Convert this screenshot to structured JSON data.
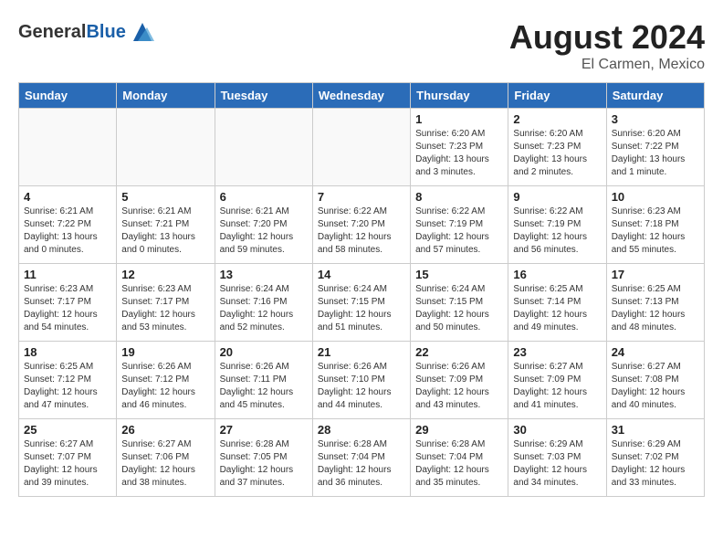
{
  "header": {
    "logo_general": "General",
    "logo_blue": "Blue",
    "month_year": "August 2024",
    "location": "El Carmen, Mexico"
  },
  "days_of_week": [
    "Sunday",
    "Monday",
    "Tuesday",
    "Wednesday",
    "Thursday",
    "Friday",
    "Saturday"
  ],
  "weeks": [
    [
      {
        "day": "",
        "info": ""
      },
      {
        "day": "",
        "info": ""
      },
      {
        "day": "",
        "info": ""
      },
      {
        "day": "",
        "info": ""
      },
      {
        "day": "1",
        "info": "Sunrise: 6:20 AM\nSunset: 7:23 PM\nDaylight: 13 hours\nand 3 minutes."
      },
      {
        "day": "2",
        "info": "Sunrise: 6:20 AM\nSunset: 7:23 PM\nDaylight: 13 hours\nand 2 minutes."
      },
      {
        "day": "3",
        "info": "Sunrise: 6:20 AM\nSunset: 7:22 PM\nDaylight: 13 hours\nand 1 minute."
      }
    ],
    [
      {
        "day": "4",
        "info": "Sunrise: 6:21 AM\nSunset: 7:22 PM\nDaylight: 13 hours\nand 0 minutes."
      },
      {
        "day": "5",
        "info": "Sunrise: 6:21 AM\nSunset: 7:21 PM\nDaylight: 13 hours\nand 0 minutes."
      },
      {
        "day": "6",
        "info": "Sunrise: 6:21 AM\nSunset: 7:20 PM\nDaylight: 12 hours\nand 59 minutes."
      },
      {
        "day": "7",
        "info": "Sunrise: 6:22 AM\nSunset: 7:20 PM\nDaylight: 12 hours\nand 58 minutes."
      },
      {
        "day": "8",
        "info": "Sunrise: 6:22 AM\nSunset: 7:19 PM\nDaylight: 12 hours\nand 57 minutes."
      },
      {
        "day": "9",
        "info": "Sunrise: 6:22 AM\nSunset: 7:19 PM\nDaylight: 12 hours\nand 56 minutes."
      },
      {
        "day": "10",
        "info": "Sunrise: 6:23 AM\nSunset: 7:18 PM\nDaylight: 12 hours\nand 55 minutes."
      }
    ],
    [
      {
        "day": "11",
        "info": "Sunrise: 6:23 AM\nSunset: 7:17 PM\nDaylight: 12 hours\nand 54 minutes."
      },
      {
        "day": "12",
        "info": "Sunrise: 6:23 AM\nSunset: 7:17 PM\nDaylight: 12 hours\nand 53 minutes."
      },
      {
        "day": "13",
        "info": "Sunrise: 6:24 AM\nSunset: 7:16 PM\nDaylight: 12 hours\nand 52 minutes."
      },
      {
        "day": "14",
        "info": "Sunrise: 6:24 AM\nSunset: 7:15 PM\nDaylight: 12 hours\nand 51 minutes."
      },
      {
        "day": "15",
        "info": "Sunrise: 6:24 AM\nSunset: 7:15 PM\nDaylight: 12 hours\nand 50 minutes."
      },
      {
        "day": "16",
        "info": "Sunrise: 6:25 AM\nSunset: 7:14 PM\nDaylight: 12 hours\nand 49 minutes."
      },
      {
        "day": "17",
        "info": "Sunrise: 6:25 AM\nSunset: 7:13 PM\nDaylight: 12 hours\nand 48 minutes."
      }
    ],
    [
      {
        "day": "18",
        "info": "Sunrise: 6:25 AM\nSunset: 7:12 PM\nDaylight: 12 hours\nand 47 minutes."
      },
      {
        "day": "19",
        "info": "Sunrise: 6:26 AM\nSunset: 7:12 PM\nDaylight: 12 hours\nand 46 minutes."
      },
      {
        "day": "20",
        "info": "Sunrise: 6:26 AM\nSunset: 7:11 PM\nDaylight: 12 hours\nand 45 minutes."
      },
      {
        "day": "21",
        "info": "Sunrise: 6:26 AM\nSunset: 7:10 PM\nDaylight: 12 hours\nand 44 minutes."
      },
      {
        "day": "22",
        "info": "Sunrise: 6:26 AM\nSunset: 7:09 PM\nDaylight: 12 hours\nand 43 minutes."
      },
      {
        "day": "23",
        "info": "Sunrise: 6:27 AM\nSunset: 7:09 PM\nDaylight: 12 hours\nand 41 minutes."
      },
      {
        "day": "24",
        "info": "Sunrise: 6:27 AM\nSunset: 7:08 PM\nDaylight: 12 hours\nand 40 minutes."
      }
    ],
    [
      {
        "day": "25",
        "info": "Sunrise: 6:27 AM\nSunset: 7:07 PM\nDaylight: 12 hours\nand 39 minutes."
      },
      {
        "day": "26",
        "info": "Sunrise: 6:27 AM\nSunset: 7:06 PM\nDaylight: 12 hours\nand 38 minutes."
      },
      {
        "day": "27",
        "info": "Sunrise: 6:28 AM\nSunset: 7:05 PM\nDaylight: 12 hours\nand 37 minutes."
      },
      {
        "day": "28",
        "info": "Sunrise: 6:28 AM\nSunset: 7:04 PM\nDaylight: 12 hours\nand 36 minutes."
      },
      {
        "day": "29",
        "info": "Sunrise: 6:28 AM\nSunset: 7:04 PM\nDaylight: 12 hours\nand 35 minutes."
      },
      {
        "day": "30",
        "info": "Sunrise: 6:29 AM\nSunset: 7:03 PM\nDaylight: 12 hours\nand 34 minutes."
      },
      {
        "day": "31",
        "info": "Sunrise: 6:29 AM\nSunset: 7:02 PM\nDaylight: 12 hours\nand 33 minutes."
      }
    ]
  ]
}
